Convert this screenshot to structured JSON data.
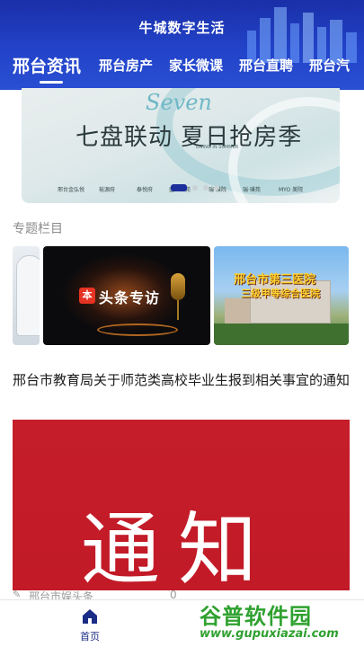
{
  "header": {
    "app_title": "牛城数字生活",
    "tabs": [
      {
        "label": "邢台资讯",
        "active": true
      },
      {
        "label": "邢台房产"
      },
      {
        "label": "家长微课"
      },
      {
        "label": "邢台直聘"
      },
      {
        "label": "邢台汽"
      }
    ],
    "colors": {
      "bar": "#2243c9",
      "text": "#ffffff"
    }
  },
  "banner": {
    "script_text": "Seven",
    "headline": "七盘联动 夏日抢房季",
    "sub_text": "LIVING IN SUMMER",
    "logos": [
      "邢台金弘悦",
      "裕源府",
      "泰悦府",
      "盛世名苑",
      "瑞·璞院",
      "瑞·璞苑",
      "MYO 美院"
    ],
    "carousel_dots": 4,
    "active_dot": 0
  },
  "section": {
    "title": "专题栏目",
    "thumbnails": [
      {
        "name": "doctor"
      },
      {
        "text": "头条专访",
        "badge": "本"
      },
      {
        "line1": "邢台市第三医院",
        "line2": "三级甲等综合医院"
      }
    ]
  },
  "article": {
    "title": "邢台市教育局关于师范类高校毕业生报到相关事宜的通知",
    "image_text": "通知",
    "source": "邢台市娱头条",
    "meta": "0"
  },
  "bottom_nav": {
    "home_label": "首页",
    "home_icon": "home-icon",
    "accent": "#1b2c86"
  },
  "watermark": {
    "text_cn": "谷普软件园",
    "url": "www.gupuxiazai.com"
  }
}
